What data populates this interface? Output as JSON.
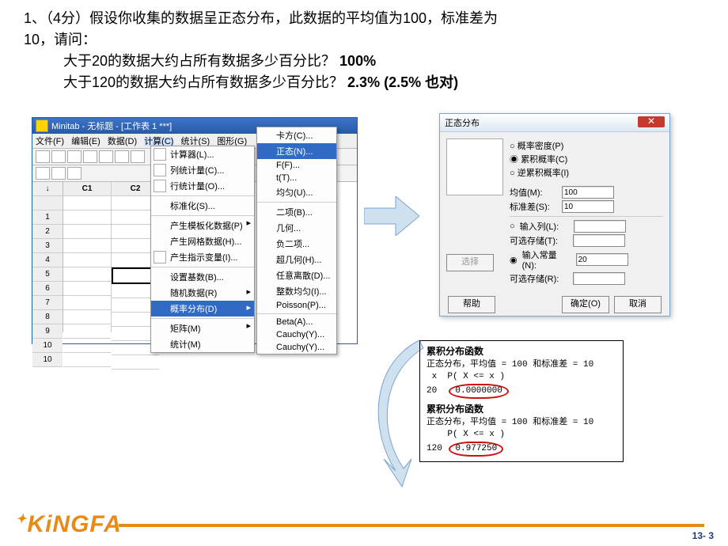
{
  "question": {
    "line1": "1、（4分）假设你收集的数据呈正态分布，此数据的平均值为100，标准差为",
    "line2": "10，请问：",
    "q1": "大于20的数据大约占所有数据多少百分比？",
    "a1": "100%",
    "q2": "大于120的数据大约占所有数据多少百分比？",
    "a2": "2.3% (2.5% 也对)"
  },
  "minitab": {
    "title": "Minitab - 无标题 - [工作表 1 ***]",
    "menus": [
      "文件(F)",
      "编辑(E)",
      "数据(D)",
      "计算(C)",
      "统计(S)",
      "图形(G)"
    ],
    "cols": [
      "C1",
      "C2"
    ],
    "rows": [
      "1",
      "2",
      "3",
      "4",
      "5",
      "6",
      "7",
      "8",
      "9",
      "10",
      "10"
    ]
  },
  "menu1": {
    "items": [
      {
        "t": "计算器(L)...",
        "i": 1
      },
      {
        "t": "列统计量(C)...",
        "i": 1
      },
      {
        "t": "行统计量(O)...",
        "i": 1
      },
      {
        "t": "标准化(S)...",
        "sep": 1
      },
      {
        "t": "产生模板化数据(P)",
        "sep": 1,
        "arr": 1
      },
      {
        "t": "产生网格数据(H)..."
      },
      {
        "t": "产生指示变量(I)...",
        "i": 1
      },
      {
        "t": "设置基数(B)...",
        "sep": 1
      },
      {
        "t": "随机数据(R)",
        "arr": 1
      },
      {
        "t": "概率分布(D)",
        "hl": 1,
        "arr": 1
      },
      {
        "t": "矩阵(M)",
        "sep": 1,
        "arr": 1
      },
      {
        "t": "统计(M)"
      }
    ]
  },
  "menu2": {
    "items": [
      {
        "t": "卡方(C)..."
      },
      {
        "t": "正态(N)...",
        "hl": 1
      },
      {
        "t": "F(F)..."
      },
      {
        "t": "t(T)..."
      },
      {
        "t": "均匀(U)..."
      },
      {
        "t": "二项(B)...",
        "sep": 1
      },
      {
        "t": "几何..."
      },
      {
        "t": "负二项..."
      },
      {
        "t": "超几何(H)..."
      },
      {
        "t": "任意离散(D)..."
      },
      {
        "t": "整数均匀(I)..."
      },
      {
        "t": "Poisson(P)..."
      },
      {
        "t": "Beta(A)...",
        "sep": 1
      },
      {
        "t": "Cauchy(Y)..."
      },
      {
        "t": "Cauchy(Y)..."
      }
    ]
  },
  "dialog": {
    "title": "正态分布",
    "opts": {
      "pdf": "概率密度(P)",
      "cdf": "累积概率(C)",
      "inv": "逆累积概率(I)",
      "mean_l": "均值(M):",
      "mean_v": "100",
      "sd_l": "标准差(S):",
      "sd_v": "10",
      "col_l": "输入列(L):",
      "col_v": "",
      "store1": "可选存储(T):",
      "const_l": "输入常量(N):",
      "const_v": "20",
      "store2": "可选存储(R):"
    },
    "btn_select": "选择",
    "btn_help": "帮助",
    "btn_ok": "确定(O)",
    "btn_cancel": "取消"
  },
  "output": {
    "t1": "累积分布函数",
    "d1": "正态分布，平均值 = 100 和标准差 = 10",
    "h": " x  P( X <= x )",
    "r1a": "20",
    "r1b": "0.0000000",
    "t2": "累积分布函数",
    "d2": "正态分布，平均值 = 100 和标准差 = 10",
    "h2": "    P( X <= x )",
    "r2a": "120",
    "r2b": "0.977250"
  },
  "logo": "KiNGFA",
  "page_no": "13- 3"
}
